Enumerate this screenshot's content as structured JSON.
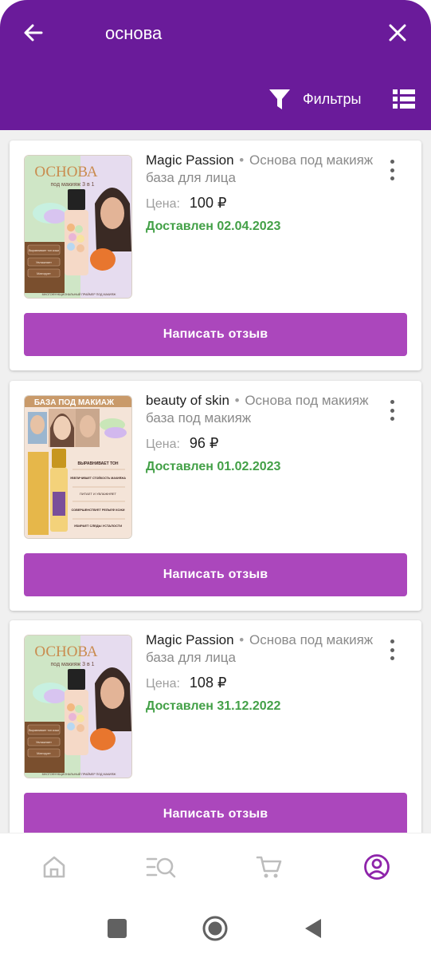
{
  "header": {
    "search_query": "основа",
    "filters_label": "Фильтры"
  },
  "icons": {
    "back": "arrow-left-icon",
    "close": "close-icon",
    "filter": "funnel-icon",
    "view": "list-view-icon",
    "more": "more-vertical-icon"
  },
  "colors": {
    "header": "#6a1b9a",
    "button": "#ab47bc",
    "delivered": "#43a047",
    "nav_active": "#8e24aa"
  },
  "orders": [
    {
      "brand": "Magic Passion",
      "separator": "•",
      "desc": "Основа под макияж база для лица",
      "price_label": "Цена:",
      "price": "100 ₽",
      "delivered": "Доставлен 02.04.2023",
      "button": "Написать отзыв",
      "image": {
        "heading": "ОСНОВА",
        "subheading": "под макияж 3 в 1",
        "tags": [
          "Выравнивает тон кожи",
          "Увлажняет",
          "Матирует"
        ],
        "footer": "МНОГОФУНКЦИОНАЛЬНЫЙ ПРАЙМЕР ПОД МАКИЯЖ"
      }
    },
    {
      "brand": "beauty of skin",
      "separator": "•",
      "desc": "Основа под макияж база под макияж",
      "price_label": "Цена:",
      "price": "96 ₽",
      "delivered": "Доставлен 01.02.2023",
      "button": "Написать отзыв",
      "image": {
        "heading": "БАЗА ПОД МАКИАЖ",
        "tags": [
          "ВЫРАВНИВАЕТ ТОН",
          "УВЕЛИЧИВАЕТ СТОЙКОСТЬ МАКИЯЖА",
          "ПИТАЕТ И УВЛАЖНЯЕТ",
          "СОВЕРШЕНСТВУЕТ РЕЛЬЕФ КОЖИ",
          "УБИРАЕТ СЛЕДЫ УСТАЛОСТИ"
        ]
      }
    },
    {
      "brand": "Magic Passion",
      "separator": "•",
      "desc": "Основа под макияж база для лица",
      "price_label": "Цена:",
      "price": "108 ₽",
      "delivered": "Доставлен 31.12.2022",
      "button": "Написать отзыв",
      "image": {
        "heading": "ОСНОВА",
        "subheading": "под макияж 3 в 1",
        "tags": [
          "Выравнивает тон кожи",
          "Увлажняет",
          "Матирует"
        ],
        "footer": "МНОГОФУНКЦИОНАЛЬНЫЙ ПРАЙМЕР ПОД МАКИЯЖ"
      }
    }
  ],
  "bottom_nav": [
    "home-icon",
    "catalog-search-icon",
    "cart-icon",
    "profile-icon"
  ],
  "system_nav": [
    "recents-square-icon",
    "home-circle-icon",
    "back-triangle-icon"
  ]
}
